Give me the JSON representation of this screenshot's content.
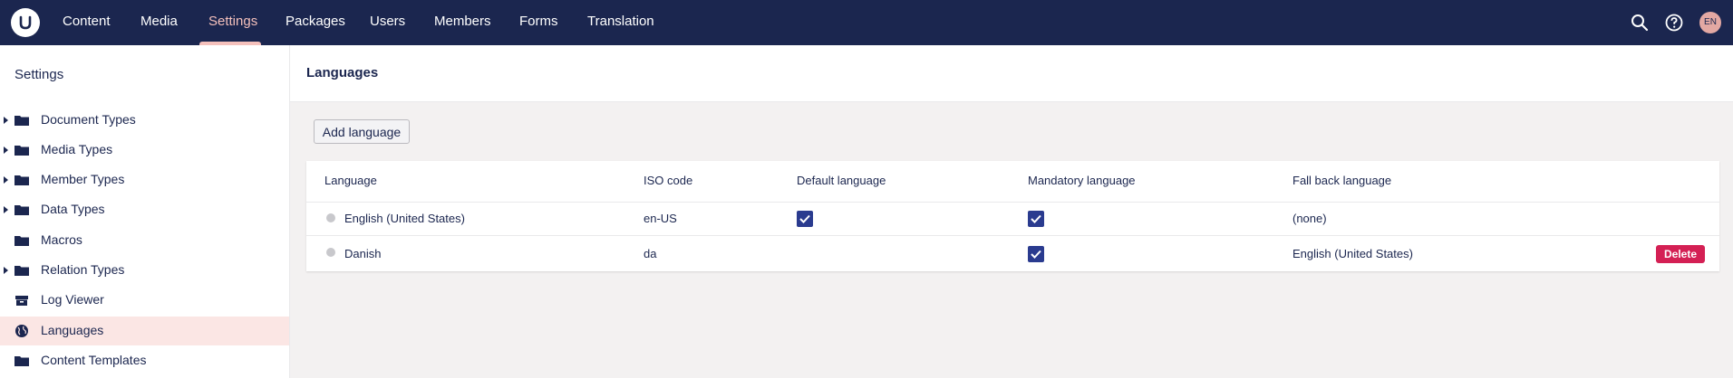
{
  "header": {
    "nav": [
      {
        "label": "Content"
      },
      {
        "label": "Media"
      },
      {
        "label": "Settings"
      },
      {
        "label": "Packages"
      },
      {
        "label": "Users"
      },
      {
        "label": "Members"
      },
      {
        "label": "Forms"
      },
      {
        "label": "Translation"
      }
    ],
    "active_nav": "Settings",
    "avatar_initials": "EN",
    "icons": [
      "search-icon",
      "help-icon"
    ],
    "colors": {
      "bar": "#1b264f",
      "active": "#f5c1bc"
    }
  },
  "sidebar": {
    "title": "Settings",
    "items": [
      {
        "label": "Document Types",
        "icon": "folder-icon"
      },
      {
        "label": "Media Types",
        "icon": "folder-icon"
      },
      {
        "label": "Member Types",
        "icon": "folder-icon"
      },
      {
        "label": "Data Types",
        "icon": "folder-icon"
      },
      {
        "label": "Macros",
        "icon": "folder-icon"
      },
      {
        "label": "Relation Types",
        "icon": "folder-icon"
      },
      {
        "label": "Log Viewer",
        "icon": "archive-icon"
      },
      {
        "label": "Languages",
        "icon": "globe-icon"
      },
      {
        "label": "Content Templates",
        "icon": "folder-icon"
      }
    ],
    "active_item": "Languages"
  },
  "main": {
    "title": "Languages",
    "add_button": "Add language",
    "table": {
      "columns": [
        "Language",
        "ISO code",
        "Default language",
        "Mandatory language",
        "Fall back language"
      ],
      "rows": [
        {
          "language": "English (United States)",
          "iso": "en-US",
          "default": true,
          "mandatory": true,
          "fallback": "(none)"
        },
        {
          "language": "Danish",
          "iso": "da",
          "default": false,
          "mandatory": true,
          "fallback": "English (United States)",
          "action": "Delete"
        }
      ]
    }
  }
}
